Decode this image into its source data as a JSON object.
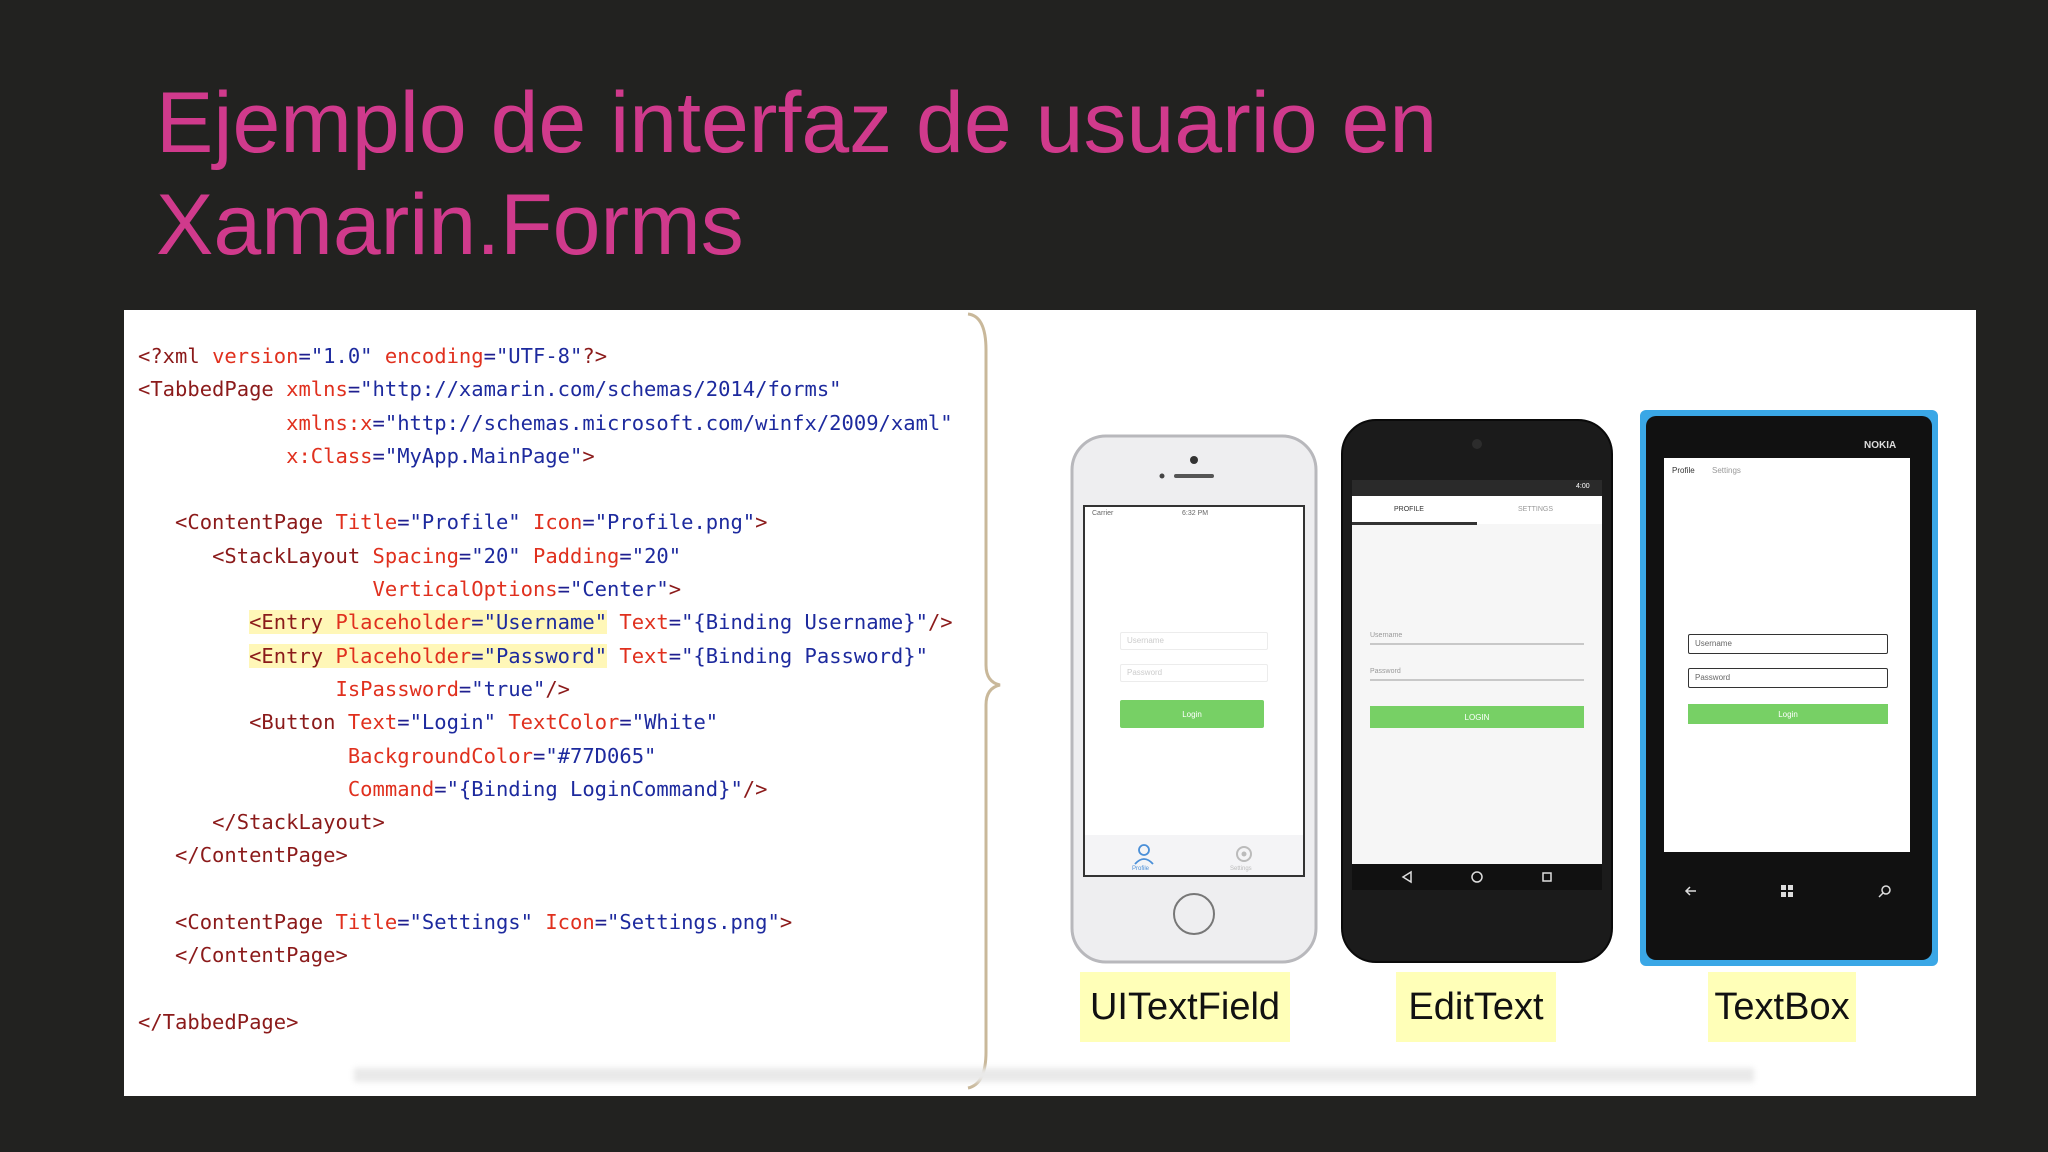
{
  "slide": {
    "title_line1": "Ejemplo de interfaz de usuario en",
    "title_line2": "Xamarin.Forms"
  },
  "code_lines": [
    "<?xml version=\"1.0\" encoding=\"UTF-8\"?>",
    "<TabbedPage xmlns=\"http://xamarin.com/schemas/2014/forms\"",
    "            xmlns:x=\"http://schemas.microsoft.com/winfx/2009/xaml\"",
    "            x:Class=\"MyApp.MainPage\">",
    "",
    "   <ContentPage Title=\"Profile\" Icon=\"Profile.png\">",
    "      <StackLayout Spacing=\"20\" Padding=\"20\"",
    "                   VerticalOptions=\"Center\">",
    "         <Entry Placeholder=\"Username\" Text=\"{Binding Username}\"/>",
    "         <Entry Placeholder=\"Password\" Text=\"{Binding Password}\"",
    "                IsPassword=\"true\"/>",
    "         <Button Text=\"Login\" TextColor=\"White\"",
    "                 BackgroundColor=\"#77D065\"",
    "                 Command=\"{Binding LoginCommand}\"/>",
    "      </StackLayout>",
    "   </ContentPage>",
    "",
    "   <ContentPage Title=\"Settings\" Icon=\"Settings.png\">",
    "   </ContentPage>",
    "",
    "</TabbedPage>"
  ],
  "phones": {
    "ios": {
      "label": "UITextField",
      "carrier": "Carrier",
      "time": "6:32 PM",
      "username_placeholder": "Username",
      "password_placeholder": "Password",
      "login": "Login",
      "tab1": "Profile",
      "tab2": "Settings",
      "icon_tab1": "person-icon",
      "icon_tab2": "gear-icon"
    },
    "android": {
      "label": "EditText",
      "time": "4:00",
      "tab1": "PROFILE",
      "tab2": "SETTINGS",
      "username_placeholder": "Username",
      "password_placeholder": "Password",
      "login": "LOGIN",
      "icon_back": "back-triangle-icon",
      "icon_home": "home-circle-icon",
      "icon_recent": "recent-square-icon"
    },
    "windows": {
      "label": "TextBox",
      "brand": "NOKIA",
      "tab1": "Profile",
      "tab2": "Settings",
      "username_placeholder": "Username",
      "password_placeholder": "Password",
      "login": "Login",
      "icon_back": "back-arrow-icon",
      "icon_start": "windows-logo-icon",
      "icon_search": "search-icon"
    }
  },
  "colors": {
    "title": "#d03a8c",
    "login_green": "#77D065",
    "label_bg": "#ffffb8",
    "nokia_blue": "#3aa7e6"
  }
}
